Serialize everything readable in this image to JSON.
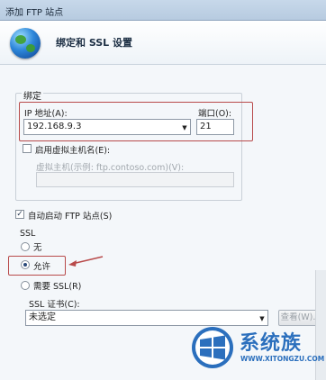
{
  "window": {
    "title": "添加 FTP 站点"
  },
  "header": {
    "title": "绑定和 SSL 设置"
  },
  "binding": {
    "group_label": "绑定",
    "ip_label": "IP 地址(A):",
    "ip_value": "192.168.9.3",
    "port_label": "端口(O):",
    "port_value": "21",
    "virtual_host_checkbox": "启用虚拟主机名(E):",
    "virtual_host_checked": false,
    "virtual_host_hint": "虚拟主机(示例: ftp.contoso.com)(V):",
    "virtual_host_value": ""
  },
  "auto_start": {
    "label": "自动启动 FTP 站点(S)",
    "checked": true
  },
  "ssl": {
    "label": "SSL",
    "options": [
      "无",
      "允许",
      "需要 SSL(R)"
    ],
    "selected": "允许",
    "cert_label": "SSL 证书(C):",
    "cert_value": "未选定",
    "view_button": "查看(W)..."
  },
  "watermark": {
    "brand": "系统族",
    "url": "WWW.XITONGZU.COM"
  },
  "colors": {
    "accent": "#2b6fbd",
    "annotation": "#b84a4a"
  }
}
